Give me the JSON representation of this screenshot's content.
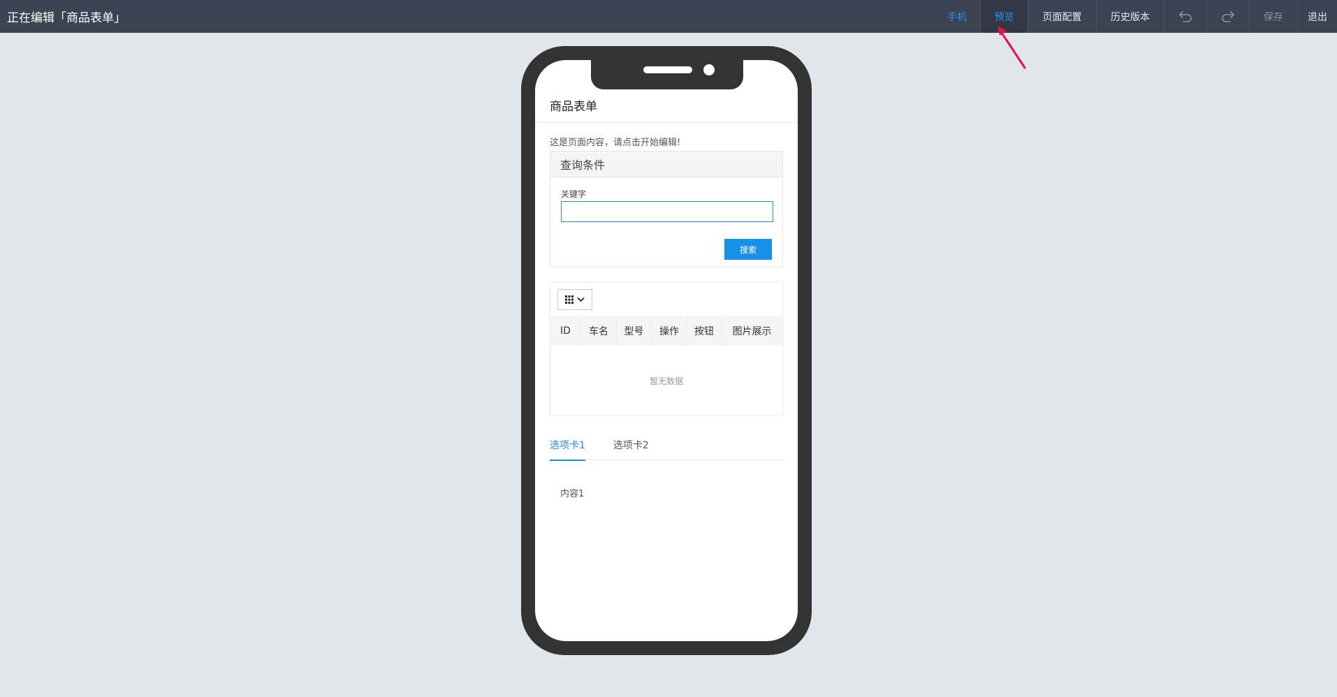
{
  "header": {
    "title": "正在编辑「商品表单」",
    "actions": {
      "phone": "手机",
      "preview": "预览",
      "page_config": "页面配置",
      "history": "历史版本",
      "save": "保存",
      "exit": "退出"
    }
  },
  "phone_page": {
    "title": "商品表单",
    "hint": "这是页面内容，请点击开始编辑!",
    "query_panel": {
      "title": "查询条件",
      "keyword_label": "关键字",
      "keyword_value": "",
      "search_button": "搜索"
    },
    "table": {
      "columns": [
        "ID",
        "车名",
        "型号",
        "操作",
        "按钮",
        "图片展示"
      ],
      "empty_text": "暂无数据"
    },
    "tabs": {
      "items": [
        "选项卡1",
        "选项卡2"
      ],
      "active_index": 0,
      "content": "内容1"
    }
  },
  "colors": {
    "topbar_bg": "#3b4252",
    "accent": "#1890e8",
    "page_bg": "#e1e6ed",
    "annotation_arrow": "#e8123c"
  },
  "icons": [
    "undo-icon",
    "redo-icon",
    "grid-icon",
    "chevron-down-icon",
    "red-arrow-annotation"
  ]
}
